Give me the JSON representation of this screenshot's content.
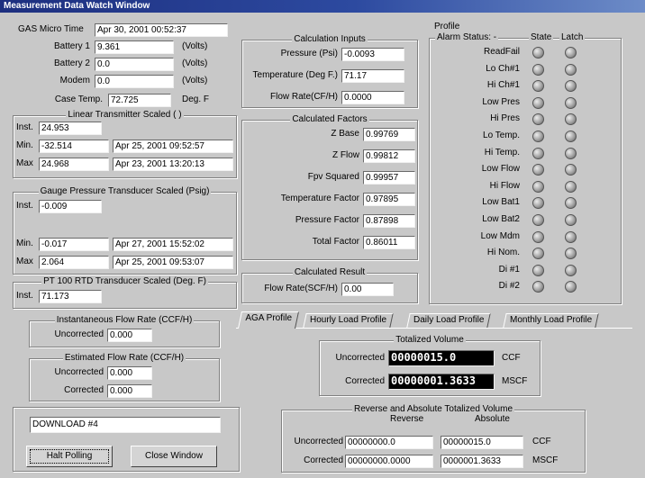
{
  "window": {
    "title": "Measurement Data Watch Window"
  },
  "left": {
    "gas_micro_time_label": "GAS Micro Time",
    "gas_micro_time_value": "Apr 30, 2001 00:52:37",
    "battery1_label": "Battery 1",
    "battery1_value": "9.361",
    "battery1_unit": "(Volts)",
    "battery2_label": "Battery 2",
    "battery2_value": "0.0",
    "battery2_unit": "(Volts)",
    "modem_label": "Modem",
    "modem_value": "0.0",
    "modem_unit": "(Volts)",
    "case_temp_label": "Case Temp.",
    "case_temp_value": "72.725",
    "case_temp_unit": "Deg. F",
    "linear": {
      "title": "Linear Transmitter Scaled ( )",
      "inst_label": "Inst.",
      "inst_value": "24.953",
      "min_label": "Min.",
      "min_value": "-32.514",
      "min_time": "Apr 25, 2001 09:52:57",
      "max_label": "Max",
      "max_value": "24.968",
      "max_time": "Apr 23, 2001 13:20:13"
    },
    "gauge": {
      "title": "Gauge Pressure Transducer Scaled (Psig)",
      "inst_label": "Inst.",
      "inst_value": "-0.009",
      "min_label": "Min.",
      "min_value": "-0.017",
      "min_time": "Apr 27, 2001 15:52:02",
      "max_label": "Max",
      "max_value": "2.064",
      "max_time": "Apr 25, 2001 09:53:07"
    },
    "pt100": {
      "title": "PT 100 RTD Transducer Scaled (Deg. F)",
      "inst_label": "Inst.",
      "inst_value": "71.173"
    },
    "inst_flow": {
      "title": "Instantaneous Flow Rate (CCF/H)",
      "uncorrected_label": "Uncorrected",
      "uncorrected_value": "0.000"
    },
    "est_flow": {
      "title": "Estimated Flow Rate (CCF/H)",
      "uncorrected_label": "Uncorrected",
      "uncorrected_value": "0.000",
      "corrected_label": "Corrected",
      "corrected_value": "0.000"
    },
    "status_text": "DOWNLOAD #4",
    "halt_button": "Halt Polling",
    "close_button": "Close Window"
  },
  "calc_inputs": {
    "title": "Calculation Inputs",
    "pressure_label": "Pressure (Psi)",
    "pressure_value": "-0.0093",
    "temperature_label": "Temperature (Deg F.)",
    "temperature_value": "71.17",
    "flow_label": "Flow Rate(CF/H)",
    "flow_value": "0.0000"
  },
  "calc_factors": {
    "title": "Calculated Factors",
    "zbase_label": "Z Base",
    "zbase_value": "0.99769",
    "zflow_label": "Z Flow",
    "zflow_value": "0.99812",
    "fpv_label": "Fpv Squared",
    "fpv_value": "0.99957",
    "tempf_label": "Temperature Factor",
    "tempf_value": "0.97895",
    "presf_label": "Pressure Factor",
    "presf_value": "0.87898",
    "total_label": "Total Factor",
    "total_value": "0.86011"
  },
  "calc_result": {
    "title": "Calculated Result",
    "flow_label": "Flow Rate(SCF/H)",
    "flow_value": "0.00"
  },
  "profile": {
    "title": "Profile",
    "alarm_label": "Alarm Status: -",
    "state_label": "State",
    "latch_label": "Latch",
    "alarms": [
      "ReadFail",
      "Lo Ch#1",
      "Hi Ch#1",
      "Low Pres",
      "Hi Pres",
      "Lo Temp.",
      "Hi Temp.",
      "Low Flow",
      "Hi Flow",
      "Low Bat1",
      "Low Bat2",
      "Low Mdm",
      "Hi Nom.",
      "Di #1",
      "Di #2"
    ]
  },
  "tabs": [
    "AGA Profile",
    "Hourly Load Profile",
    "Daily Load Profile",
    "Monthly Load Profile"
  ],
  "totalized": {
    "title": "Totalized Volume",
    "uncorrected_label": "Uncorrected",
    "uncorrected_value": "00000015.0",
    "uncorrected_unit": "CCF",
    "corrected_label": "Corrected",
    "corrected_value": "00000001.3633",
    "corrected_unit": "MSCF"
  },
  "rev_abs": {
    "title": "Reverse and Absolute Totalized Volume",
    "reverse_header": "Reverse",
    "absolute_header": "Absolute",
    "uncorrected_label": "Uncorrected",
    "uncorrected_reverse": "00000000.0",
    "uncorrected_absolute": "00000015.0",
    "uncorrected_unit": "CCF",
    "corrected_label": "Corrected",
    "corrected_reverse": "00000000.0000",
    "corrected_absolute": "0000001.3633",
    "corrected_unit": "MSCF"
  }
}
